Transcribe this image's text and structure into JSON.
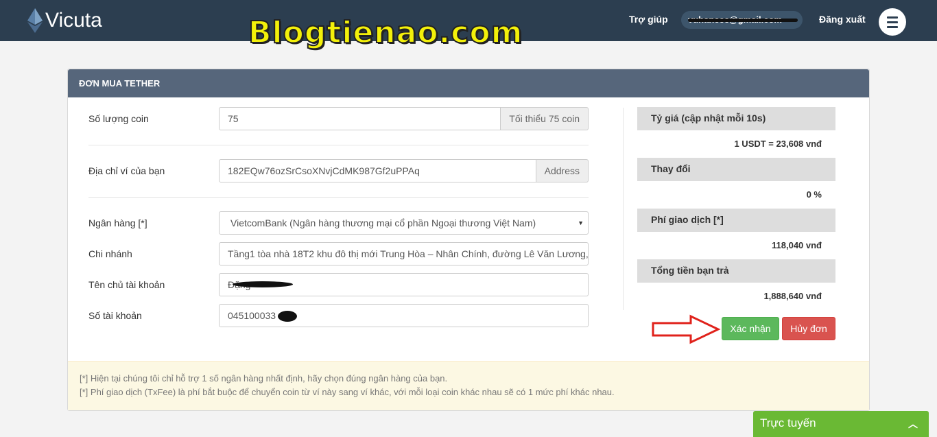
{
  "header": {
    "logo_text": "Vicuta",
    "watermark": "Blogtienao.com",
    "help": "Trợ giúp",
    "email": "vuhanccc@gmail.com",
    "logout": "Đăng xuất",
    "menu_icon": "hamburger-icon"
  },
  "panel": {
    "title": "ĐƠN MUA TETHER",
    "fields": {
      "coin_amount": {
        "label": "Số lượng coin",
        "value": "75",
        "addon": "Tối thiểu 75 coin"
      },
      "wallet": {
        "label": "Địa chỉ ví của bạn",
        "value": "182EQw76ozSrCsoXNvjCdMK987Gf2uPPAq",
        "addon": "Address"
      },
      "bank": {
        "label": "Ngân hàng [*]",
        "value": "VietcomBank (Ngân hàng thương mại cổ phần Ngoại thương Việt Nam)"
      },
      "branch": {
        "label": "Chi nhánh",
        "value": "Tầng1 tòa nhà 18T2 khu đô thị mới Trung Hòa – Nhân Chính, đường Lê Văn Lương,"
      },
      "holder": {
        "label": "Tên chủ tài khoản",
        "value": "Đặng"
      },
      "account": {
        "label": "Số tài khoản",
        "value": "045100033"
      }
    },
    "summary": {
      "rate_label": "Tỷ giá (cập nhật mỗi 10s)",
      "rate_value": "1 USDT = 23,608 vnđ",
      "change_label": "Thay đổi",
      "change_value": "0 %",
      "fee_label": "Phí giao dịch [*]",
      "fee_value": "118,040 vnđ",
      "total_label": "Tổng tiền bạn trả",
      "total_value": "1,888,640 vnđ"
    },
    "buttons": {
      "confirm": "Xác nhận",
      "cancel": "Hủy đơn"
    },
    "notes": [
      "[*] Hiện tại chúng tôi chỉ hỗ trợ 1 số ngân hàng nhất định, hãy chọn đúng ngân hàng của bạn.",
      "[*] Phí giao dịch (TxFee) là phí bắt buộc để chuyển coin từ ví này sang ví khác, với mỗi loại coin khác nhau sẽ có 1 mức phí khác nhau."
    ]
  },
  "chat": {
    "label": "Trực tuyến",
    "icon": "chevron-up-icon"
  },
  "colors": {
    "navbar": "#2c3e50",
    "panel_header": "#56667b",
    "confirm": "#5cb85c",
    "cancel": "#d9534f",
    "chat": "#6ab934",
    "watermark": "#f3f00a"
  }
}
